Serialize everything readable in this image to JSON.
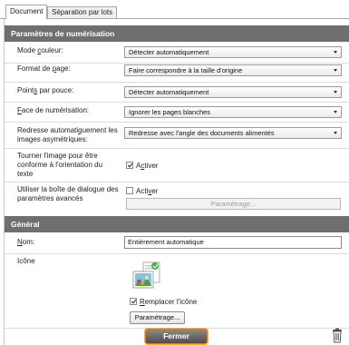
{
  "tabs": [
    {
      "label": "Document",
      "active": true
    },
    {
      "label": "Séparation par lots",
      "active": false
    }
  ],
  "scan_settings": {
    "header": "Paramètres de numérisation",
    "mode_couleur": {
      "label_pre": "Mode ",
      "label_key": "c",
      "label_post": "ouleur:",
      "value": "Détecter automatiquement"
    },
    "format_page": {
      "label_pre": "Format de ",
      "label_key": "p",
      "label_post": "age:",
      "value": "Faire correspondre à la taille d'origine"
    },
    "points_pouce": {
      "label_pre": "Point",
      "label_key": "s",
      "label_post": " par pouce:",
      "value": "Détecter automatiquement"
    },
    "face_numerisation": {
      "label_pre": "",
      "label_key": "F",
      "label_post": "ace de numérisation:",
      "value": "Ignorer les pages blanches"
    },
    "redresse": {
      "label_pre": "Redresse automati",
      "label_key": "q",
      "label_post": "uement les images asymétriques:",
      "value": "Redresse avec l'angle des documents alimentés"
    },
    "tourner": {
      "label": "Tourner l'image pour être conforme à l'orientation du texte",
      "checkbox_pre": "A",
      "checkbox_key": "c",
      "checkbox_post": "tiver",
      "checked": true
    },
    "dialogue": {
      "label": "Utiliser la boîte de dialogue des paramètres avancés",
      "checkbox_pre": "Acti",
      "checkbox_key": "v",
      "checkbox_post": "er",
      "checked": false,
      "button_pre": "Paramétra",
      "button_key": "g",
      "button_post": "e..."
    }
  },
  "general": {
    "header": "Général",
    "nom": {
      "label_key": "N",
      "label_post": "om:",
      "value": "Entièrement automatique"
    },
    "icone": {
      "label": "Icône",
      "replace_key": "R",
      "replace_post": "emplacer l'icône",
      "replace_checked": true,
      "button_label": "Paramétrage..."
    }
  },
  "footer": {
    "close_label": "Fermer",
    "trash_icon": "trash-icon"
  },
  "colors": {
    "header_bg": "#6f6f6f",
    "close_border": "#e07a10"
  }
}
